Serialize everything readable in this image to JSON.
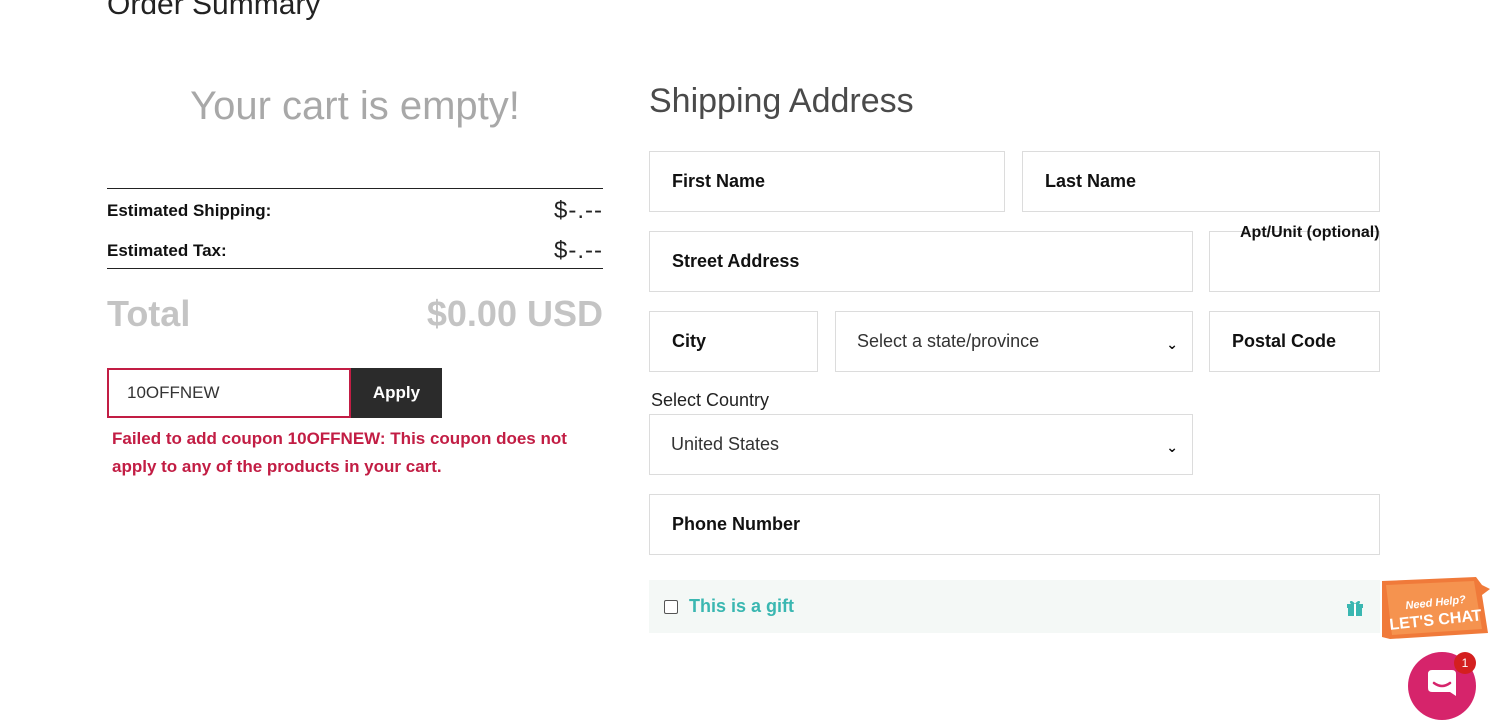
{
  "page": {
    "title": "Order Summary"
  },
  "cart": {
    "empty_message": "Your cart is empty!",
    "estimated_shipping_label": "Estimated Shipping:",
    "estimated_shipping_value": "$-.--",
    "estimated_tax_label": "Estimated Tax:",
    "estimated_tax_value": "$-.--",
    "total_label": "Total",
    "total_value": "$0.00 USD"
  },
  "coupon": {
    "value": "10OFFNEW",
    "apply_label": "Apply",
    "error_message": "Failed to add coupon 10OFFNEW: This coupon does not apply to any of the products in your cart."
  },
  "shipping": {
    "title": "Shipping Address",
    "first_name": "First Name",
    "last_name": "Last Name",
    "street_address": "Street Address",
    "apt_unit": "Apt/Unit (optional)",
    "city": "City",
    "state_select": "Select a state/province",
    "postal_code": "Postal Code",
    "country_label": "Select Country",
    "country_value": "United States",
    "phone_number": "Phone Number"
  },
  "gift": {
    "label": "This is a gift",
    "checked": false
  },
  "chat": {
    "badge_text": "Need Help? LET'S CHAT",
    "unread_count": "1"
  },
  "colors": {
    "error": "#c21d44",
    "accent_teal": "#3ab7b1",
    "chat_pink": "#d6246b",
    "apply_bg": "#2b2b2b"
  },
  "icons": [
    "chevron-down-icon",
    "gift-icon",
    "chat-icon"
  ]
}
